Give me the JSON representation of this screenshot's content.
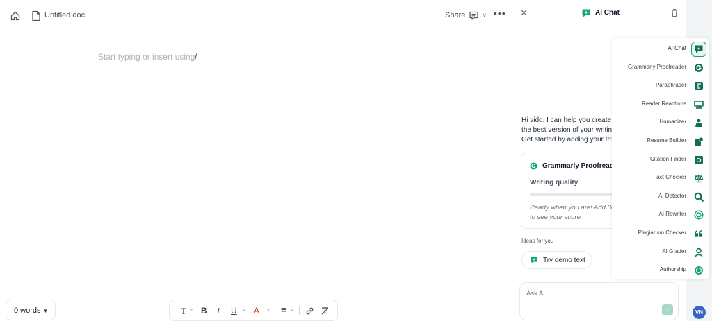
{
  "header": {
    "doc_title": "Untitled doc",
    "share_label": "Share",
    "more_label": "•••"
  },
  "editor": {
    "placeholder": "Start typing or insert using",
    "slash": "/"
  },
  "footer": {
    "word_count": "0 words"
  },
  "format_toolbar": {
    "text_style": "T",
    "bold": "B",
    "italic": "I",
    "underline": "U",
    "text_color": "A",
    "align": "≡",
    "link": "∞",
    "clear": "T̸",
    "caret": "˅",
    "text_color_hex": "#c2410c"
  },
  "chat": {
    "title": "AI Chat",
    "close": "✕",
    "greeting": "Hi vidd, I can help you create the best version of your writing. Get started by adding your text to the doc.",
    "card": {
      "title": "Grammarly Proofreader",
      "subtitle": "Writing quality",
      "note_line1": "Ready when you are! Add 30+",
      "note_line2": "to see your score."
    },
    "ideas_label": "Ideas for you",
    "demo_button": "Try demo text",
    "ask_placeholder": "Ask AI",
    "send": "↑"
  },
  "tools": [
    {
      "label": "AI Chat",
      "icon": "chat-icon",
      "active": true
    },
    {
      "label": "Grammarly Proofreader",
      "icon": "grammarly-icon"
    },
    {
      "label": "Paraphraser",
      "icon": "paraphraser-icon"
    },
    {
      "label": "Reader Reactions",
      "icon": "reactions-icon"
    },
    {
      "label": "Humanizer",
      "icon": "humanizer-icon"
    },
    {
      "label": "Resume Builder",
      "icon": "resume-icon"
    },
    {
      "label": "Citation Finder",
      "icon": "citation-icon"
    },
    {
      "label": "Fact Checker",
      "icon": "scale-icon"
    },
    {
      "label": "AI Detector",
      "icon": "detector-icon"
    },
    {
      "label": "AI Rewriter",
      "icon": "rewriter-icon"
    },
    {
      "label": "Plagiarism Checker",
      "icon": "quote-icon"
    },
    {
      "label": "AI Grader",
      "icon": "grader-icon"
    },
    {
      "label": "Authorship",
      "icon": "authorship-icon"
    }
  ],
  "user": {
    "initials": "VN"
  },
  "colors": {
    "accent": "#15a37f",
    "accent_dark": "#0f6e57"
  }
}
